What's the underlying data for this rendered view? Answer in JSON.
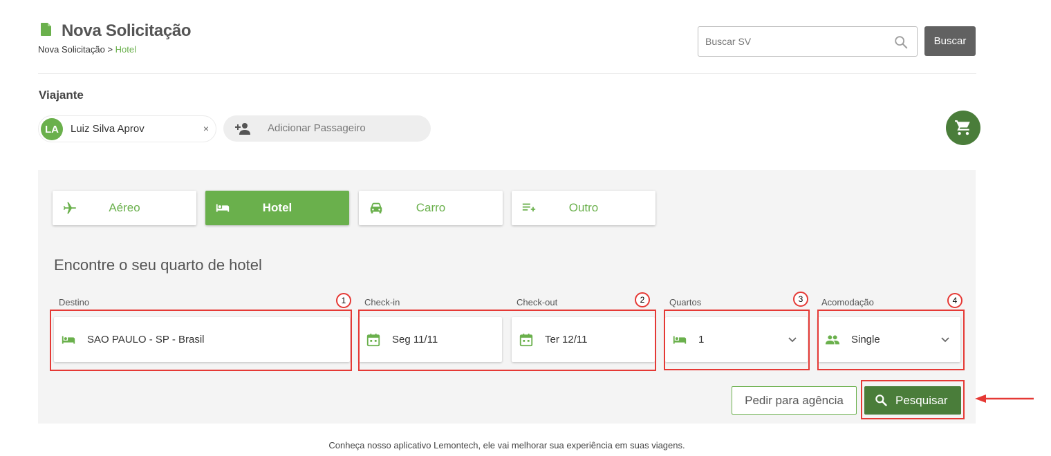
{
  "header": {
    "title": "Nova Solicitação",
    "breadcrumb": {
      "parent": "Nova Solicitação",
      "separator": " > ",
      "current": "Hotel"
    },
    "search": {
      "placeholder": "Buscar SV",
      "button_label": "Buscar"
    }
  },
  "travellers": {
    "section_label": "Viajante",
    "chips": [
      {
        "initials": "LA",
        "name": "Luiz Silva Aprov",
        "remove": "×"
      }
    ],
    "add_label": "Adicionar Passageiro"
  },
  "tabs": [
    {
      "label": "Aéreo",
      "icon": "airplane-icon",
      "active": false
    },
    {
      "label": "Hotel",
      "icon": "bed-icon",
      "active": true
    },
    {
      "label": "Carro",
      "icon": "car-icon",
      "active": false
    },
    {
      "label": "Outro",
      "icon": "playlist-add-icon",
      "active": false
    }
  ],
  "form": {
    "heading": "Encontre o seu quarto de hotel",
    "destino": {
      "label": "Destino",
      "value": "SAO PAULO - SP - Brasil",
      "marker": "1"
    },
    "checkin": {
      "label": "Check-in",
      "value": "Seg 11/11"
    },
    "checkout": {
      "label": "Check-out",
      "value": "Ter 12/11"
    },
    "dates_marker": "2",
    "quartos": {
      "label": "Quartos",
      "value": "1",
      "marker": "3"
    },
    "acomodacao": {
      "label": "Acomodação",
      "value": "Single",
      "marker": "4"
    }
  },
  "actions": {
    "agency_label": "Pedir para agência",
    "search_label": "Pesquisar"
  },
  "footer_text": "Conheça nosso aplicativo Lemontech, ele vai melhorar sua experiência em suas viagens.",
  "colors": {
    "brand_green": "#6ab04c",
    "dark_green": "#4a7d3a",
    "annotation_red": "#e53935"
  }
}
